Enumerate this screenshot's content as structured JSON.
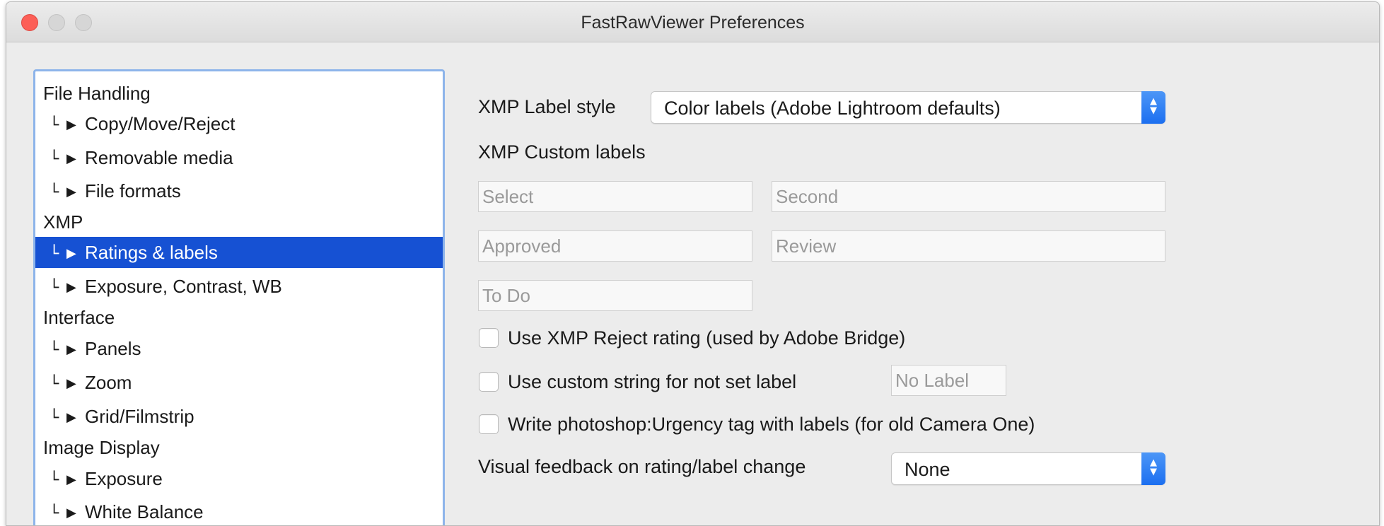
{
  "window": {
    "title": "FastRawViewer Preferences"
  },
  "sidebar": {
    "branch_glyph": "└",
    "arrow_glyph": "▶",
    "items": [
      {
        "label": "File Handling",
        "level": 0,
        "selected": false
      },
      {
        "label": "Copy/Move/Reject",
        "level": 1,
        "selected": false
      },
      {
        "label": "Removable media",
        "level": 1,
        "selected": false
      },
      {
        "label": "File formats",
        "level": 1,
        "selected": false
      },
      {
        "label": "XMP",
        "level": 0,
        "selected": false
      },
      {
        "label": "Ratings & labels",
        "level": 1,
        "selected": true
      },
      {
        "label": "Exposure, Contrast, WB",
        "level": 1,
        "selected": false
      },
      {
        "label": "Interface",
        "level": 0,
        "selected": false
      },
      {
        "label": "Panels",
        "level": 1,
        "selected": false
      },
      {
        "label": "Zoom",
        "level": 1,
        "selected": false
      },
      {
        "label": "Grid/Filmstrip",
        "level": 1,
        "selected": false
      },
      {
        "label": "Image Display",
        "level": 0,
        "selected": false
      },
      {
        "label": "Exposure",
        "level": 1,
        "selected": false
      },
      {
        "label": "White Balance",
        "level": 1,
        "selected": false
      }
    ]
  },
  "settings": {
    "label_style": {
      "label": "XMP Label style",
      "value": "Color labels (Adobe Lightroom defaults)"
    },
    "custom_labels": {
      "heading": "XMP Custom labels",
      "fields": [
        "Select",
        "Second",
        "Approved",
        "Review",
        "To Do"
      ]
    },
    "reject_rating": {
      "label": "Use XMP Reject rating (used by Adobe Bridge)",
      "checked": false
    },
    "custom_string": {
      "label": "Use custom string for not set label",
      "checked": false,
      "placeholder": "No Label"
    },
    "urgency_tag": {
      "label": "Write photoshop:Urgency tag with labels (for old Camera One)",
      "checked": false
    },
    "visual_feedback": {
      "label": "Visual feedback on rating/label change",
      "value": "None"
    }
  },
  "colors": {
    "selection": "#1651d3",
    "accent": "#1c6ff0",
    "focus_ring": "#8db4ea",
    "close_button": "#fc5f57"
  },
  "icons": {
    "stepper": "chevron-up-down-icon",
    "tree_branch": "tree-branch-icon",
    "tree_arrow": "triangle-right-icon"
  }
}
